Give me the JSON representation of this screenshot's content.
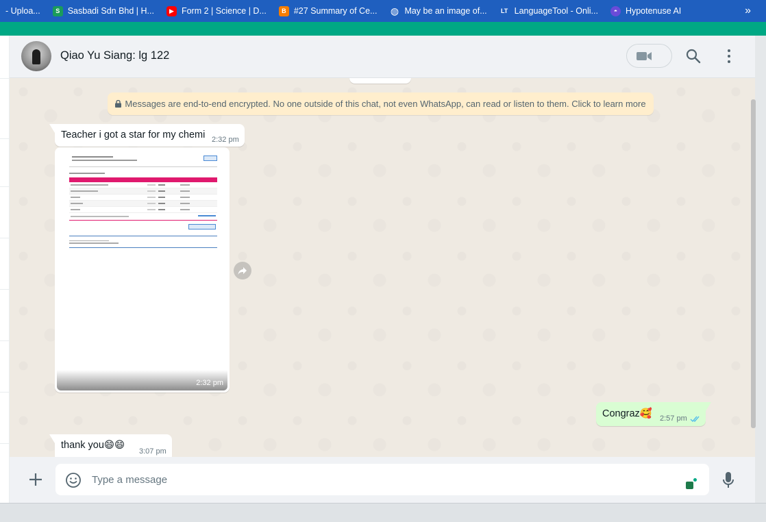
{
  "bookmarks": [
    {
      "label": "- Uploa...",
      "icon": "",
      "color": "#1f5fbf"
    },
    {
      "label": "Sasbadi Sdn Bhd | H...",
      "icon": "S",
      "color": "#1a9c5a"
    },
    {
      "label": "Form 2 | Science | D...",
      "icon": "▶",
      "color": "#ff0000"
    },
    {
      "label": "#27 Summary of Ce...",
      "icon": "B",
      "color": "#f57d00"
    },
    {
      "label": "May be an image of...",
      "icon": "◍",
      "color": "#ffffff"
    },
    {
      "label": "LanguageTool - Onli...",
      "icon": "LT",
      "color": "#3b6fd1"
    },
    {
      "label": "Hypotenuse AI",
      "icon": "◓",
      "color": "#6a4bd8"
    }
  ],
  "bookmarks_more": "»",
  "header": {
    "contact_name": "Qiao Yu Siang: lg 122"
  },
  "chat": {
    "encryption_notice": "Messages are end-to-end encrypted. No one outside of this chat, not even WhatsApp, can read or listen to them. Click to learn more",
    "messages": [
      {
        "direction": "in",
        "text": "Teacher i got a star for my chemi",
        "time": "2:32 pm"
      },
      {
        "direction": "in",
        "type": "image",
        "time": "2:32 pm"
      },
      {
        "direction": "out",
        "text": "Congraz🥰",
        "time": "2:57 pm",
        "status": "read"
      },
      {
        "direction": "in",
        "text": "thank you😄😄",
        "time": "3:07 pm"
      }
    ]
  },
  "footer": {
    "placeholder": "Type a message"
  },
  "colors": {
    "accent": "#00a884",
    "bookmark_bar": "#1f5fbf",
    "outgoing_bubble": "#d9fdd3",
    "encryption_banner": "#ffeecd",
    "read_ticks": "#53bdeb"
  }
}
